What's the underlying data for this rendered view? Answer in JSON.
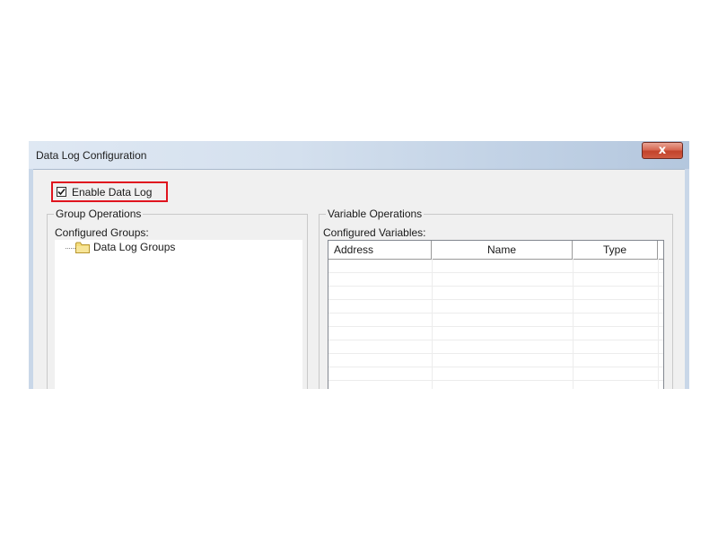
{
  "window": {
    "title": "Data Log Configuration",
    "close_glyph": "x"
  },
  "enable": {
    "label": "Enable Data Log",
    "checked": true,
    "highlight_color": "#e0141e"
  },
  "group_operations": {
    "legend": "Group Operations",
    "list_label": "Configured Groups:",
    "tree": [
      {
        "label": "Data Log Groups",
        "icon": "folder-icon"
      }
    ]
  },
  "variable_operations": {
    "legend": "Variable Operations",
    "list_label": "Configured Variables:",
    "columns": [
      "Address",
      "Name",
      "Type"
    ],
    "rows": []
  }
}
